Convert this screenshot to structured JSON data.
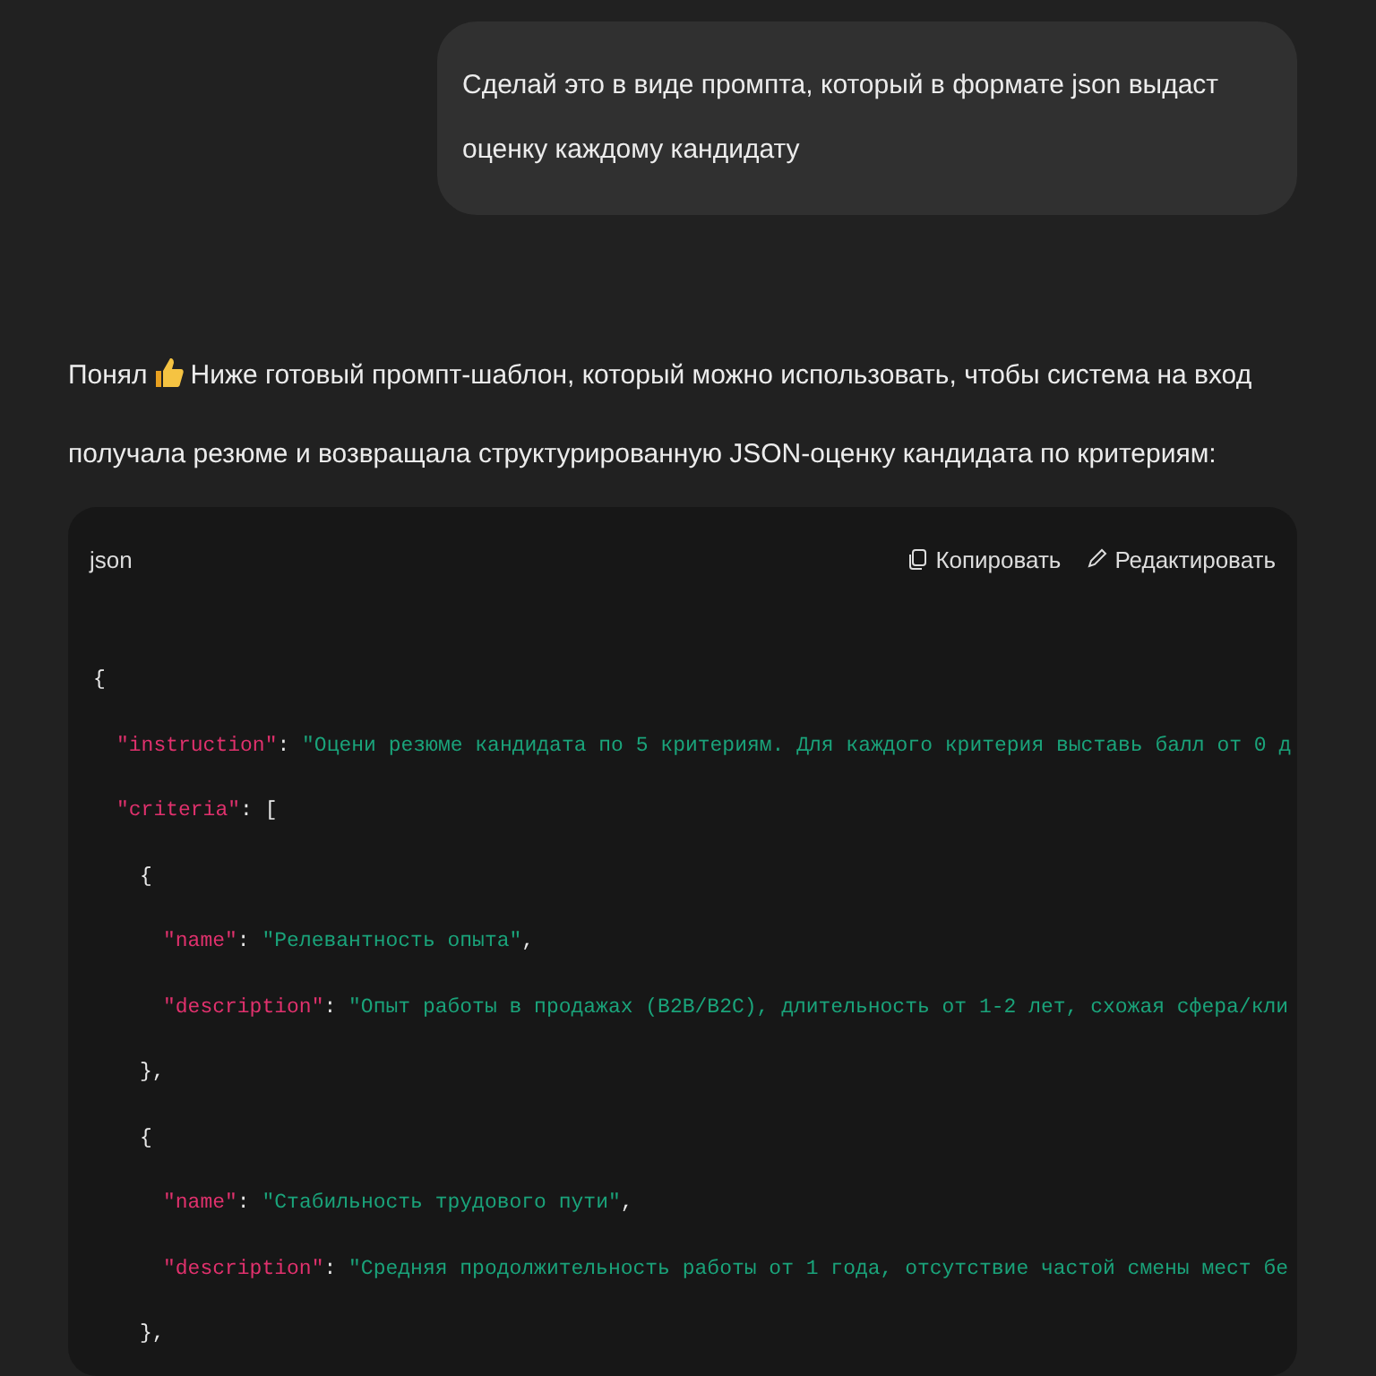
{
  "user_message": {
    "text": "Сделай это в виде промпта, который в формате json выдаст оценку каждому кандидату"
  },
  "answer": {
    "lead": "Понял",
    "text": "Ниже готовый промпт-шаблон, который можно использовать, чтобы система на вход получала резюме и возвращала структурированную JSON-оценку кандидата по критериям:"
  },
  "code_block": {
    "language": "json",
    "actions": [
      {
        "kind": "copy",
        "label": "Копировать"
      },
      {
        "kind": "edit",
        "label": "Редактировать"
      }
    ],
    "lines": [
      {
        "tokens": [
          {
            "kind": "punct",
            "text": "{"
          }
        ],
        "children": [
          {
            "tokens": [
              {
                "kind": "key",
                "text": "\"instruction\""
              },
              {
                "kind": "punct",
                "text": ": "
              },
              {
                "kind": "string",
                "text": "\"Оцени резюме кандидата по 5 критериям. Для каждого критерия выставь балл от 0 д"
              }
            ]
          },
          {
            "tokens": [
              {
                "kind": "key",
                "text": "\"criteria\""
              },
              {
                "kind": "punct",
                "text": ": ["
              }
            ],
            "children": [
              {
                "tokens": [
                  {
                    "kind": "punct",
                    "text": "{"
                  }
                ],
                "children": [
                  {
                    "tokens": [
                      {
                        "kind": "key",
                        "text": "\"name\""
                      },
                      {
                        "kind": "punct",
                        "text": ": "
                      },
                      {
                        "kind": "string",
                        "text": "\"Релевантность опыта\""
                      },
                      {
                        "kind": "punct",
                        "text": ","
                      }
                    ]
                  },
                  {
                    "tokens": [
                      {
                        "kind": "key",
                        "text": "\"description\""
                      },
                      {
                        "kind": "punct",
                        "text": ": "
                      },
                      {
                        "kind": "string",
                        "text": "\"Опыт работы в продажах (B2B/B2C), длительность от 1-2 лет, схожая сфера/кли"
                      }
                    ]
                  }
                ],
                "close": [
                  {
                    "kind": "punct",
                    "text": "},"
                  }
                ]
              },
              {
                "tokens": [
                  {
                    "kind": "punct",
                    "text": "{"
                  }
                ],
                "children": [
                  {
                    "tokens": [
                      {
                        "kind": "key",
                        "text": "\"name\""
                      },
                      {
                        "kind": "punct",
                        "text": ": "
                      },
                      {
                        "kind": "string",
                        "text": "\"Стабильность трудового пути\""
                      },
                      {
                        "kind": "punct",
                        "text": ","
                      }
                    ]
                  },
                  {
                    "tokens": [
                      {
                        "kind": "key",
                        "text": "\"description\""
                      },
                      {
                        "kind": "punct",
                        "text": ": "
                      },
                      {
                        "kind": "string",
                        "text": "\"Средняя продолжительность работы от 1 года, отсутствие частой смены мест бе"
                      }
                    ]
                  }
                ],
                "close": [
                  {
                    "kind": "punct",
                    "text": "},"
                  }
                ]
              }
            ]
          }
        ]
      }
    ]
  }
}
